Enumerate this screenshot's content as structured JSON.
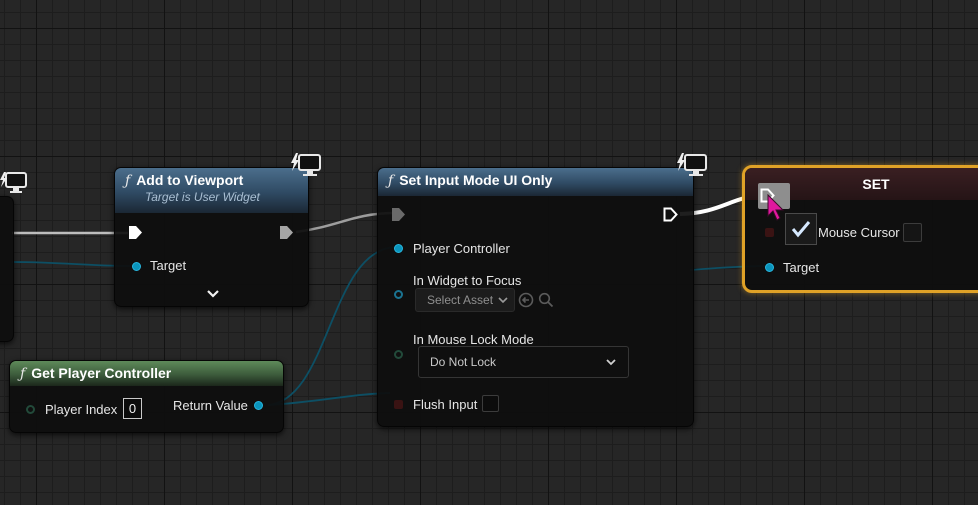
{
  "nodes": {
    "add_to_viewport": {
      "title": "Add to Viewport",
      "subtitle": "Target is User Widget",
      "pins": {
        "target": "Target"
      }
    },
    "set_input_mode": {
      "title": "Set Input Mode UI Only",
      "pins": {
        "player_controller": "Player Controller",
        "in_widget_to_focus": "In Widget to Focus",
        "select_asset": "Select Asset",
        "in_mouse_lock_mode": "In Mouse Lock Mode",
        "lock_mode_value": "Do Not Lock",
        "flush_input": "Flush Input"
      }
    },
    "set_node": {
      "title": "SET",
      "pins": {
        "show_mouse_cursor": "Mouse Cursor",
        "show_mouse_cursor_checked": true,
        "target": "Target"
      }
    },
    "get_player_controller": {
      "title": "Get Player Controller",
      "pins": {
        "player_index": "Player Index",
        "player_index_value": "0",
        "return_value": "Return Value"
      }
    }
  },
  "icons": [
    "function-icon",
    "network-icon",
    "exec-pin-icon",
    "chevron-down-icon",
    "browse-icon",
    "search-icon",
    "checkmark-icon",
    "cursor-icon"
  ],
  "colors": {
    "function_header": "#3b5a76",
    "pure_function_header": "#4e7a4b",
    "set_selected_outline": "#e0a227",
    "object_pin": "#0a95bd",
    "exec_wire": "#ffffff",
    "cursor": "#e0189e"
  }
}
